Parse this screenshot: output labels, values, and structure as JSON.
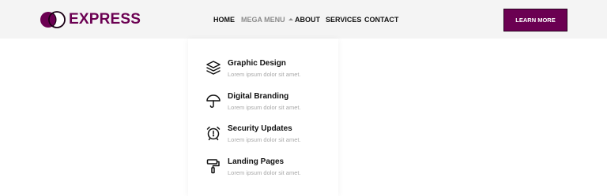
{
  "brand": {
    "name": "EXPRESS",
    "icon": "logo-circles-icon",
    "color": "#6b0052"
  },
  "nav": {
    "items": [
      {
        "label": "HOME"
      },
      {
        "label": "MEGA MENU",
        "active": true
      },
      {
        "label": "ABOUT"
      },
      {
        "label": "SERVICES"
      },
      {
        "label": "CONTACT"
      }
    ]
  },
  "cta": {
    "label": "LEARN MORE",
    "color": "#6b0052"
  },
  "mega_menu": {
    "items": [
      {
        "title": "Graphic Design",
        "description": "Lorem ipsum dolor sit amet.",
        "icon": "layers-icon"
      },
      {
        "title": "Digital Branding",
        "description": "Lorem ipsum dolor sit amet.",
        "icon": "umbrella-icon"
      },
      {
        "title": "Security Updates",
        "description": "Lorem ipsum dolor sit amet.",
        "icon": "alarm-clock-icon"
      },
      {
        "title": "Landing Pages",
        "description": "Lorem ipsum dolor sit amet.",
        "icon": "paint-roller-icon"
      }
    ]
  }
}
